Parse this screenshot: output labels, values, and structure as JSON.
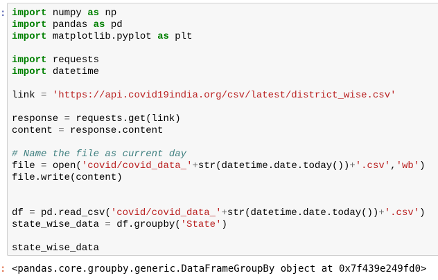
{
  "cell": {
    "in_prompt": ":",
    "out_prompt": ":",
    "code": {
      "l1_kw": "import",
      "l1_rest": " numpy ",
      "l1_kw2": "as",
      "l1_alias": " np",
      "l2_kw": "import",
      "l2_rest": " pandas ",
      "l2_kw2": "as",
      "l2_alias": " pd",
      "l3_kw": "import",
      "l3_rest": " matplotlib.pyplot ",
      "l3_kw2": "as",
      "l3_alias": " plt",
      "l5_kw": "import",
      "l5_rest": " requests",
      "l6_kw": "import",
      "l6_rest": " datetime",
      "l8_a": "link ",
      "l8_eq": "=",
      "l8_sp": " ",
      "l8_str": "'https://api.covid19india.org/csv/latest/district_wise.csv'",
      "l10_a": "response ",
      "l10_eq": "=",
      "l10_b": " requests.get(link)",
      "l11_a": "content ",
      "l11_eq": "=",
      "l11_b": " response.content",
      "l13_comment": "# Name the file as current day",
      "l14_a": "file ",
      "l14_eq": "=",
      "l14_b": " open(",
      "l14_s1": "'covid/covid_data_'",
      "l14_op1": "+",
      "l14_c": "str(datetime.date.today())",
      "l14_op2": "+",
      "l14_s2": "'.csv'",
      "l14_d": ",",
      "l14_s3": "'wb'",
      "l14_e": ")",
      "l15": "file.write(content)",
      "l18_a": "df ",
      "l18_eq": "=",
      "l18_b": " pd.read_csv(",
      "l18_s1": "'covid/covid_data_'",
      "l18_op1": "+",
      "l18_c": "str(datetime.date.today())",
      "l18_op2": "+",
      "l18_s2": "'.csv'",
      "l18_e": ")",
      "l19_a": "state_wise_data ",
      "l19_eq": "=",
      "l19_b": " df.groupby(",
      "l19_s": "'State'",
      "l19_e": ")",
      "l21": "state_wise_data"
    },
    "output_text": "<pandas.core.groupby.generic.DataFrameGroupBy object at 0x7f439e249fd0>"
  },
  "colors": {
    "keyword": "#008000",
    "string": "#ba2121",
    "comment": "#408080",
    "cell_background": "#f7f7f7",
    "cell_border": "#cfcfcf"
  }
}
